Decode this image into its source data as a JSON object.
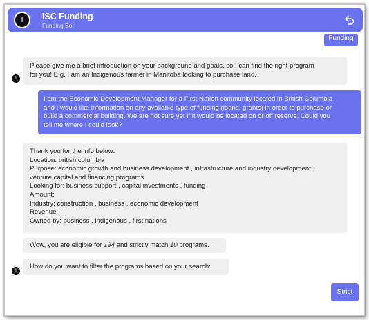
{
  "header": {
    "avatar_letter": "I",
    "title": "ISC Funding",
    "subtitle": "Funding Bot"
  },
  "top_chip": {
    "label": "Funding"
  },
  "bot_intro": {
    "lines": [
      "Please give me a brief introduction on your background and goals, so I can find the right program",
      "for you! E.g. I am an Indigenous farmer in Manitoba looking to purchase land."
    ]
  },
  "user_message": {
    "lines": [
      "I am the Economic Development Manager for a First Nation community located in British Columbia",
      "and I would like information on any available type of funding (loans, grants) in order to purchase or",
      "build a commercial building. We are not sure yet if it would be located on or off reserve. Could you",
      "tell me where I could look?"
    ]
  },
  "summary": {
    "lines": [
      "Thank you for the info below:",
      "Location: british columbia",
      "Purpose: economic growth and business development , infrastructure and industry development ,",
      "venture capital and financing programs",
      "Looking for: business support , capital investments , funding",
      "Amount:",
      "Industry: construction , business , economic development",
      "Revenue:",
      "Owned by: business , indigenous , first nations"
    ]
  },
  "eligibility": {
    "prefix": "Wow, you are eligible for ",
    "eligible_count": "194",
    "middle": " and strictly match ",
    "match_count": "10",
    "suffix": " programs."
  },
  "filter_question": {
    "text": "How do you want to filter the programs based on your search:"
  },
  "strict_button": {
    "label": "Strict"
  },
  "bot_marker": {
    "letter": "I"
  }
}
